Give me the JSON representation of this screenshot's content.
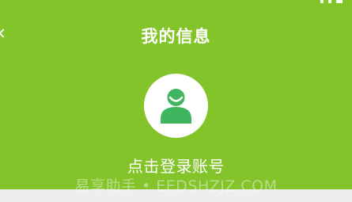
{
  "header": {
    "title": "我的信息"
  },
  "profile": {
    "login_prompt": "点击登录账号",
    "avatar_icon": "user-avatar-icon"
  },
  "watermark": {
    "text": "易享助手 • EEDSHZJZ.COM"
  },
  "colors": {
    "header_bg": "#84c42b",
    "avatar_bg": "#ffffff",
    "avatar_figure": "#3fb560",
    "panel_bg": "#eeeeee"
  }
}
